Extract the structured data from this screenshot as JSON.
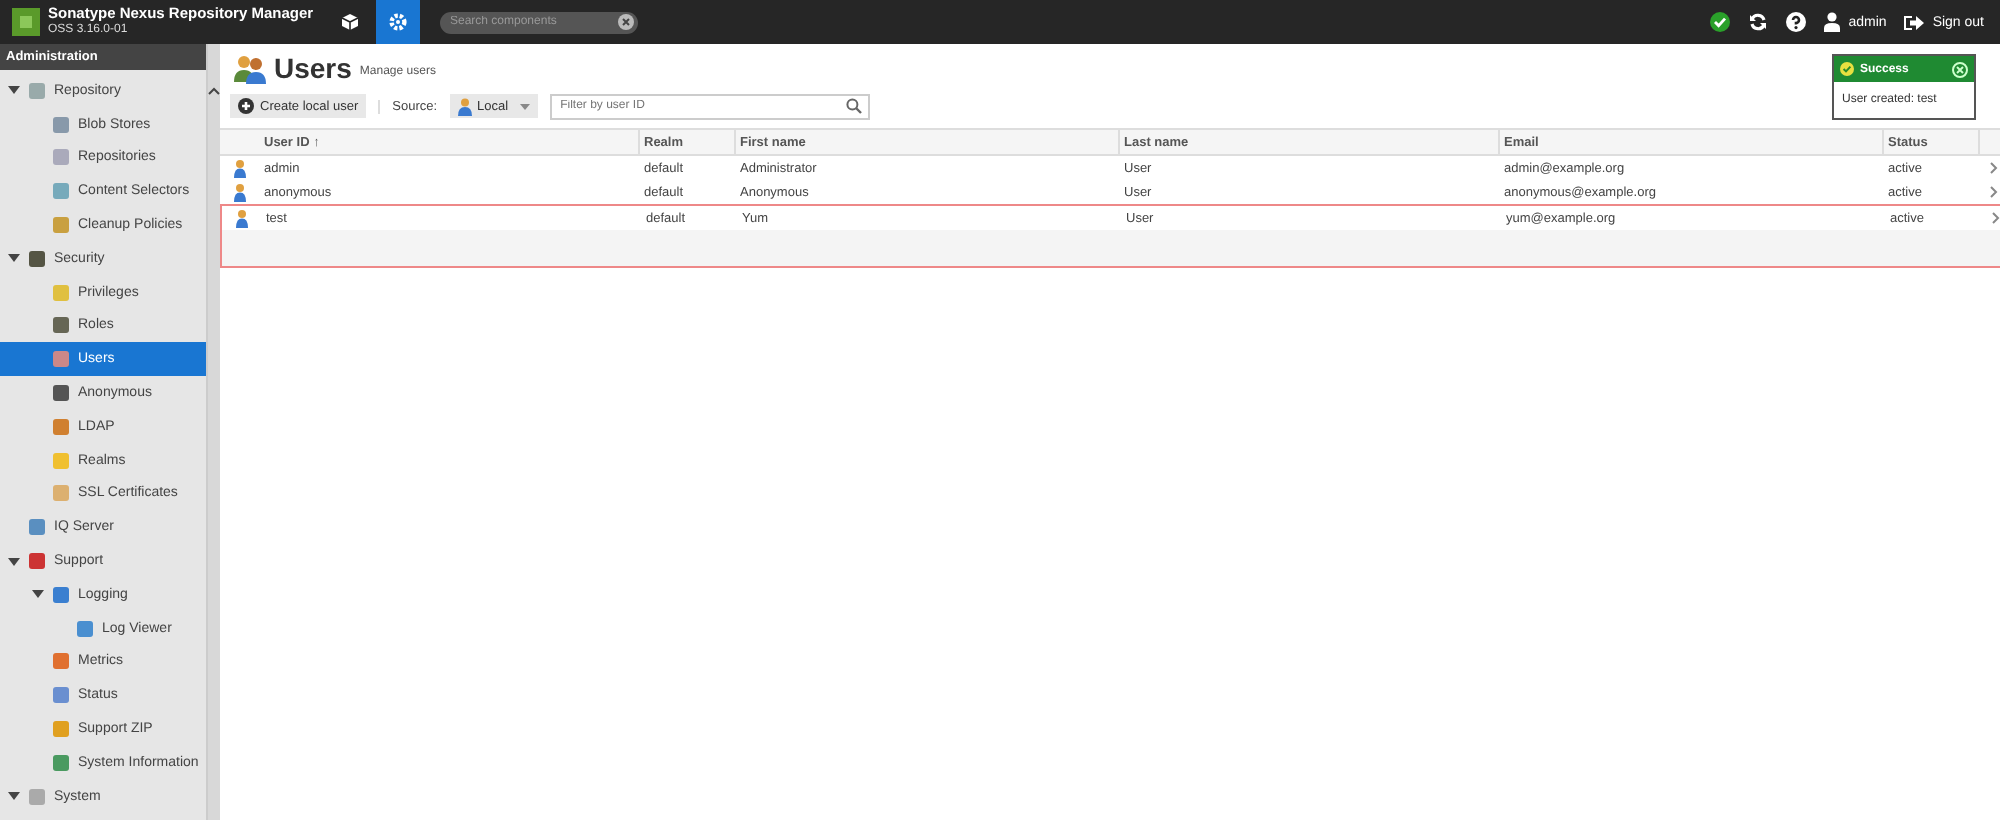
{
  "header": {
    "title": "Sonatype Nexus Repository Manager",
    "version": "OSS 3.16.0-01",
    "modes": [
      {
        "kind": "browse",
        "selected": false
      },
      {
        "kind": "admin",
        "selected": true
      }
    ],
    "search": {
      "placeholder": "Search components"
    },
    "user": "admin",
    "sign_out": "Sign out"
  },
  "sidebar": {
    "title": "Administration",
    "items": [
      {
        "label": "Repository",
        "expanded": true,
        "selected": false,
        "children": [
          {
            "label": "Blob Stores",
            "selected": false
          },
          {
            "label": "Repositories",
            "selected": false
          },
          {
            "label": "Content Selectors",
            "selected": false
          },
          {
            "label": "Cleanup Policies",
            "selected": false
          }
        ]
      },
      {
        "label": "Security",
        "expanded": true,
        "selected": false,
        "children": [
          {
            "label": "Privileges",
            "selected": false
          },
          {
            "label": "Roles",
            "selected": false
          },
          {
            "label": "Users",
            "selected": true
          },
          {
            "label": "Anonymous",
            "selected": false
          },
          {
            "label": "LDAP",
            "selected": false
          },
          {
            "label": "Realms",
            "selected": false
          },
          {
            "label": "SSL Certificates",
            "selected": false
          }
        ]
      },
      {
        "label": "IQ Server",
        "selected": false
      },
      {
        "label": "Support",
        "expanded": true,
        "selected": false,
        "children": [
          {
            "label": "Logging",
            "expanded": true,
            "selected": false,
            "children": [
              {
                "label": "Log Viewer",
                "selected": false
              }
            ]
          },
          {
            "label": "Metrics",
            "selected": false
          },
          {
            "label": "Status",
            "selected": false
          },
          {
            "label": "Support ZIP",
            "selected": false
          },
          {
            "label": "System Information",
            "selected": false
          }
        ]
      },
      {
        "label": "System",
        "expanded": true,
        "selected": false
      }
    ]
  },
  "page": {
    "title": "Users",
    "subtitle": "Manage users",
    "create_button": "Create local user",
    "source_label": "Source:",
    "source_value": "Local",
    "filter": {
      "placeholder": "Filter by user ID"
    }
  },
  "table": {
    "columns": [
      "User ID ↑",
      "Realm",
      "First name",
      "Last name",
      "Email",
      "Status"
    ],
    "rows": [
      {
        "cells": [
          "admin",
          "default",
          "Administrator",
          "User",
          "admin@example.org",
          "active"
        ],
        "highlighted": false
      },
      {
        "cells": [
          "anonymous",
          "default",
          "Anonymous",
          "User",
          "anonymous@example.org",
          "active"
        ],
        "highlighted": false
      },
      {
        "cells": [
          "test",
          "default",
          "Yum",
          "User",
          "yum@example.org",
          "active"
        ],
        "highlighted": true
      }
    ]
  },
  "toast": {
    "title": "Success",
    "message": "User created: test"
  }
}
